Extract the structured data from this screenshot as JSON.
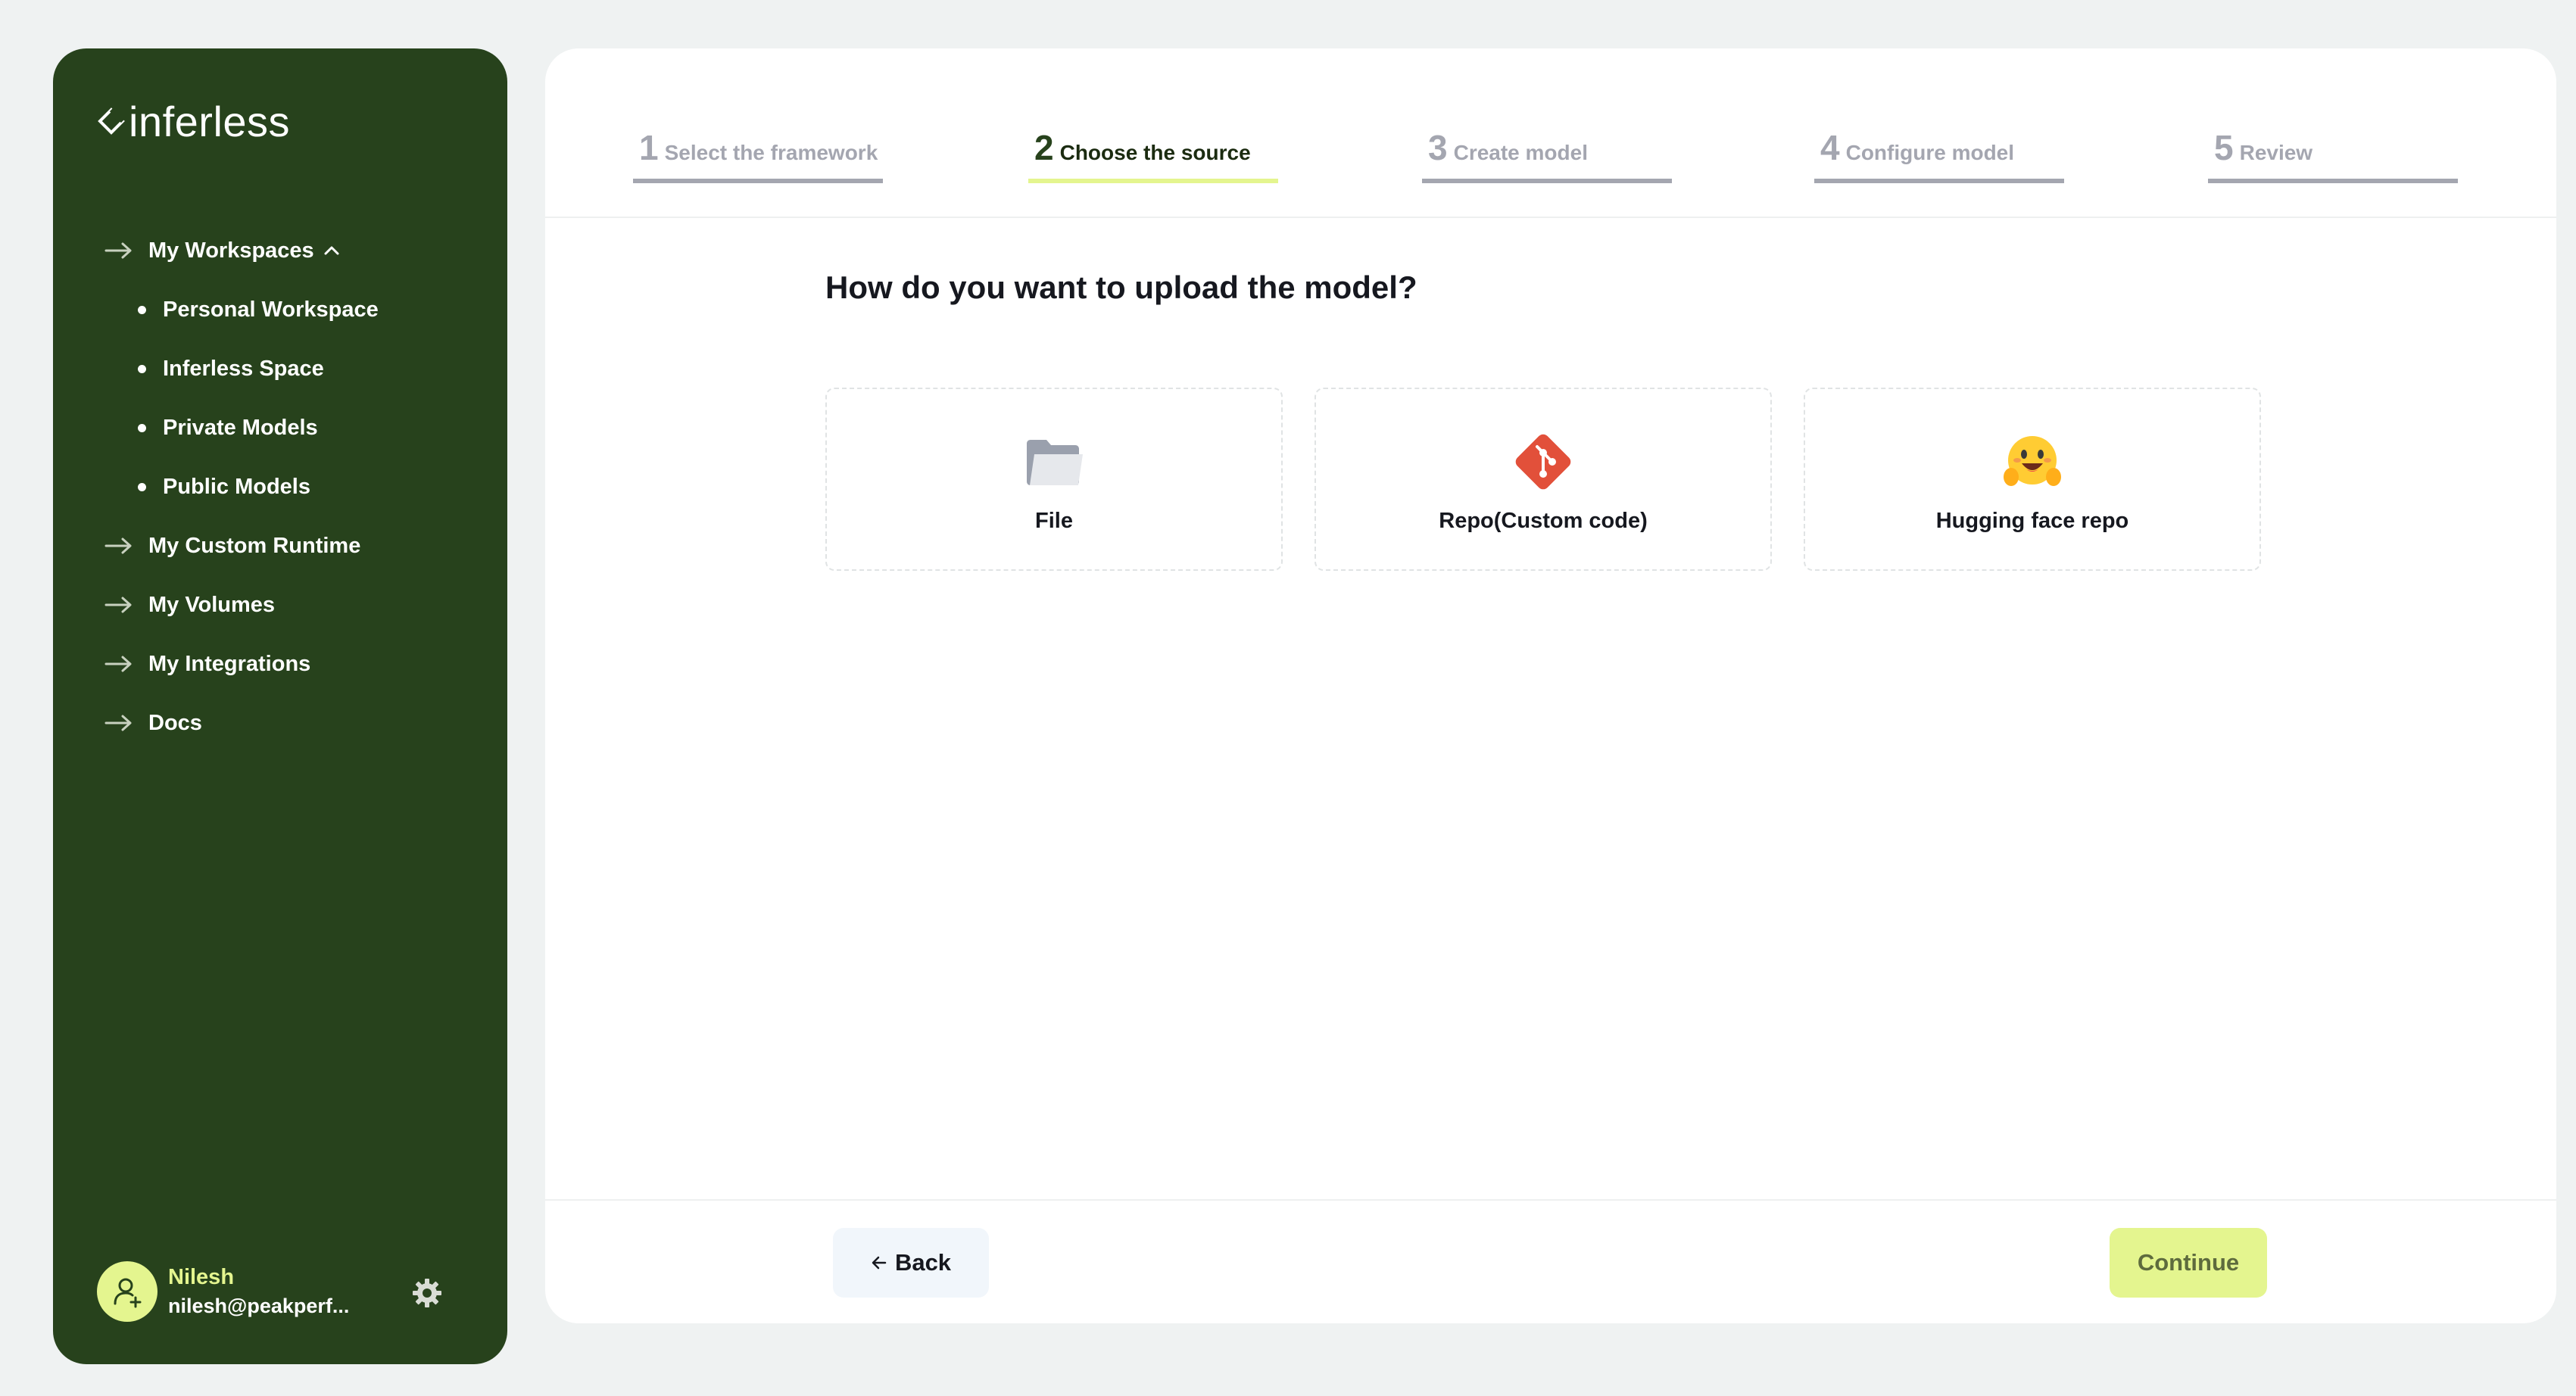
{
  "brand": {
    "name": "inferless",
    "icon": "diamond-ring-logo"
  },
  "sidebar": {
    "workspaces_label": "My Workspaces",
    "workspaces_items": [
      {
        "label": "Personal Workspace"
      },
      {
        "label": "Inferless Space"
      },
      {
        "label": "Private Models"
      },
      {
        "label": "Public Models"
      }
    ],
    "items": [
      {
        "label": "My Custom Runtime",
        "icon": "arrow-right-icon"
      },
      {
        "label": "My Volumes",
        "icon": "arrow-right-icon"
      },
      {
        "label": "My Integrations",
        "icon": "arrow-right-icon"
      },
      {
        "label": "Docs",
        "icon": "arrow-right-icon"
      }
    ],
    "user": {
      "name": "Nilesh",
      "email": "nilesh@peakperf..."
    }
  },
  "steps": [
    {
      "number": "1",
      "label": "Select the framework",
      "state": "inactive"
    },
    {
      "number": "2",
      "label": "Choose the source",
      "state": "active"
    },
    {
      "number": "3",
      "label": "Create model",
      "state": "inactive"
    },
    {
      "number": "4",
      "label": "Configure model",
      "state": "inactive"
    },
    {
      "number": "5",
      "label": "Review",
      "state": "inactive"
    }
  ],
  "main": {
    "question": "How do you want to upload the model?",
    "options": [
      {
        "label": "File",
        "icon": "folder-icon"
      },
      {
        "label": "Repo(Custom code)",
        "icon": "git-icon"
      },
      {
        "label": "Hugging face repo",
        "icon": "hugging-face-icon"
      }
    ]
  },
  "footer": {
    "back_label": "Back",
    "continue_label": "Continue"
  },
  "colors": {
    "sidebar_bg": "#27421c",
    "accent": "#e4f58f",
    "page_bg": "#eff2f2",
    "git_red": "#e2503a",
    "inactive_step": "#a4a6b0"
  }
}
